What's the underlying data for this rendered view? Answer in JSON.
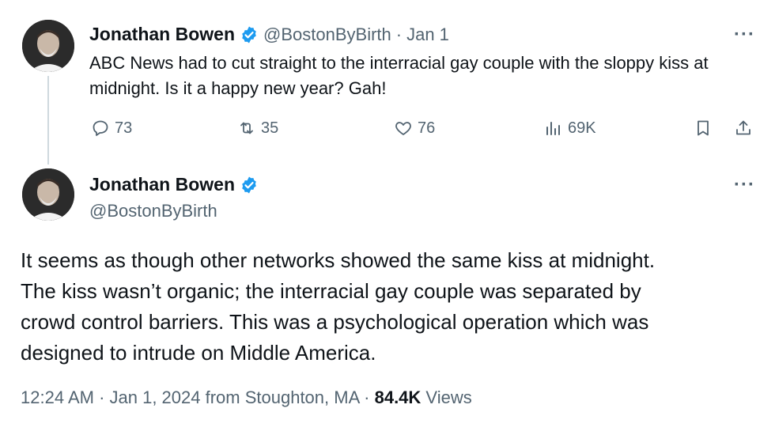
{
  "colors": {
    "verified": "#1d9bf0",
    "text": "#0f1419",
    "muted": "#536471",
    "thread_line": "#cfd9de"
  },
  "tweet1": {
    "author_name": "Jonathan Bowen",
    "handle": "@BostonByBirth",
    "separator": "·",
    "date": "Jan 1",
    "text": "ABC News had to cut straight to the interracial gay couple with the sloppy kiss at midnight. Is it a happy new year? Gah!",
    "actions": {
      "replies": "73",
      "reposts": "35",
      "likes": "76",
      "views": "69K"
    },
    "more_label": "···"
  },
  "tweet2": {
    "author_name": "Jonathan Bowen",
    "handle": "@BostonByBirth",
    "more_label": "···",
    "text_lines": [
      "It seems as though other networks showed the same kiss at midnight.",
      "The kiss wasn’t organic; the interracial gay couple was separated by",
      "crowd control barriers. This was a psychological operation which was",
      "designed to intrude on Middle America."
    ],
    "meta": {
      "time_date": "12:24 AM · Jan 1, 2024 from Stoughton, MA · ",
      "views_count": "84.4K",
      "views_label": " Views"
    }
  },
  "icons": [
    "reply-icon",
    "repost-icon",
    "like-icon",
    "views-icon",
    "bookmark-icon",
    "share-icon",
    "verified-badge-icon",
    "more-icon"
  ]
}
